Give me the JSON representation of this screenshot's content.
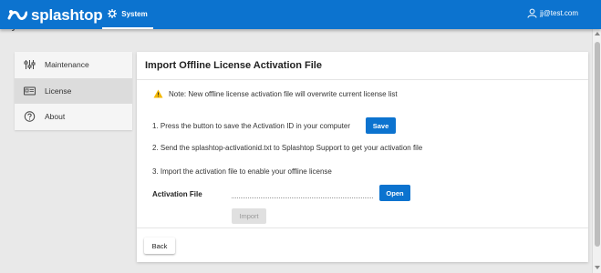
{
  "header": {
    "brand": "splashtop",
    "nav": {
      "system_label": "System",
      "system_icon": "gear-icon"
    },
    "user": {
      "email": "jj@test.com",
      "icon": "user-icon"
    },
    "color": "#0c73cf"
  },
  "page": {
    "heading": "System License"
  },
  "sidebar": {
    "items": [
      {
        "label": "Maintenance",
        "icon": "sliders-icon",
        "active": false
      },
      {
        "label": "License",
        "icon": "license-card-icon",
        "active": true
      },
      {
        "label": "About",
        "icon": "help-icon",
        "active": false
      }
    ]
  },
  "card": {
    "title": "Import Offline License Activation File",
    "note": "Note: New offline license activation file will overwrite current license list",
    "steps": [
      "1. Press the button to save the Activation ID in your computer",
      "2. Send the splashtop-activationid.txt to Splashtop Support to get your activation file",
      "3. Import the activation file to enable your offline license"
    ],
    "save_label": "Save",
    "activation_file_label": "Activation File",
    "activation_file_value": "",
    "open_label": "Open",
    "import_label": "Import",
    "back_label": "Back"
  }
}
